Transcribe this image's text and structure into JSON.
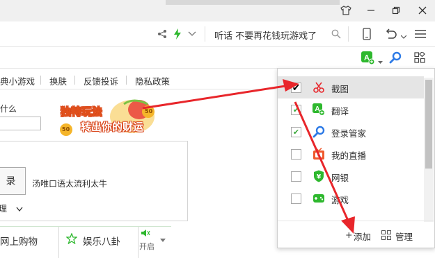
{
  "titlebar": {
    "shirt_icon": "shirt-icon",
    "minimize": "—",
    "restore": "❐",
    "close": "✕"
  },
  "address": {
    "share_icon": "share-icon",
    "bolt_icon": "lightning-icon",
    "chevron": "⌵",
    "search_text": "听话 不要再花钱玩游戏了",
    "search_icon": "search-icon"
  },
  "nav": {
    "items": [
      "典小游戏",
      "换肤",
      "反馈投诉",
      "隐私政策"
    ]
  },
  "content": {
    "category_label": "什么",
    "promo_line1": "独特玩法",
    "promo_line2": "转出你的财运",
    "promo_coin1": "50",
    "promo_coin2": "50",
    "button_label": "录",
    "ticker_text": "汤唯口语太流利太牛",
    "sub_label": "理",
    "tab1": "网上购物",
    "tab2": "娱乐八卦",
    "open_label": "开启"
  },
  "dropdown": {
    "items": [
      {
        "label": "截图",
        "checked": true,
        "icon": "scissors-icon"
      },
      {
        "label": "翻译",
        "checked": true,
        "icon": "translate-icon"
      },
      {
        "label": "登录管家",
        "checked": true,
        "icon": "search-key-icon"
      },
      {
        "label": "我的直播",
        "checked": false,
        "icon": "tv-icon"
      },
      {
        "label": "网银",
        "checked": false,
        "icon": "bank-shield-icon"
      },
      {
        "label": "游戏",
        "checked": false,
        "icon": "gamepad-icon"
      }
    ],
    "add_label": "添加",
    "add_prefix": "+",
    "manage_label": "管理"
  },
  "colors": {
    "accent_green": "#2eb82e",
    "arrow_red": "#e8262b",
    "search_blue": "#2d7ae6"
  }
}
